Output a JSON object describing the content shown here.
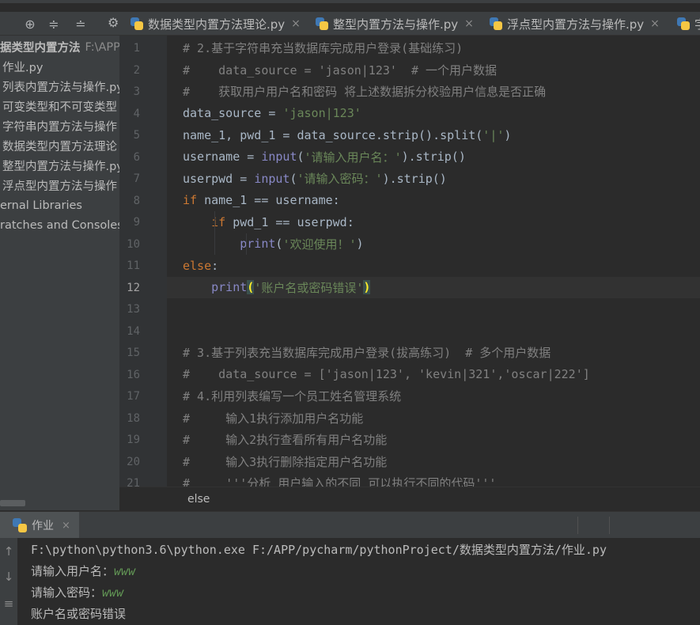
{
  "top_strip": {
    "label": "1 作业.py"
  },
  "toolbar": {
    "icons": [
      "target-icon",
      "collapse-all-icon",
      "expand-all-icon",
      "gear-icon"
    ]
  },
  "tabs": [
    {
      "label": "数据类型内置方法理论.py",
      "close": "×"
    },
    {
      "label": "整型内置方法与操作.py",
      "close": "×"
    },
    {
      "label": "浮点型内置方法与操作.py",
      "close": "×"
    },
    {
      "label": "字",
      "close": ""
    }
  ],
  "project": {
    "root_label": "据类型内置方法",
    "root_path": "F:\\APP",
    "items": [
      "作业.py",
      "列表内置方法与操作.py",
      "可变类型和不可变类型",
      "字符串内置方法与操作",
      "数据类型内置方法理论",
      "整型内置方法与操作.py",
      "浮点型内置方法与操作",
      "ernal Libraries",
      "ratches and Consoles"
    ]
  },
  "editor": {
    "current_line": 12,
    "line_numbers": [
      "1",
      "2",
      "3",
      "4",
      "5",
      "6",
      "7",
      "8",
      "9",
      "10",
      "11",
      "12",
      "13",
      "14",
      "15",
      "16",
      "17",
      "18",
      "19",
      "20",
      "21"
    ],
    "lines": [
      {
        "indent": "",
        "tokens": [
          {
            "t": "# 2.基于字符串充当数据库完成用户登录(基础练习)",
            "c": "c-comment"
          }
        ]
      },
      {
        "indent": "",
        "tokens": [
          {
            "t": "#    data_source = 'jason|123'  # 一个用户数据",
            "c": "c-comment"
          }
        ]
      },
      {
        "indent": "",
        "tokens": [
          {
            "t": "#    获取用户用户名和密码 将上述数据拆分校验用户信息是否正确",
            "c": "c-comment"
          }
        ]
      },
      {
        "indent": "",
        "tokens": [
          {
            "t": "data_source = ",
            "c": "c-var"
          },
          {
            "t": "'jason|123'",
            "c": "c-str"
          }
        ]
      },
      {
        "indent": "",
        "tokens": [
          {
            "t": "name_1, pwd_1 = data_source.strip().split(",
            "c": "c-var"
          },
          {
            "t": "'|'",
            "c": "c-str"
          },
          {
            "t": ")",
            "c": "c-var"
          }
        ]
      },
      {
        "indent": "",
        "tokens": [
          {
            "t": "username = ",
            "c": "c-var"
          },
          {
            "t": "input",
            "c": "c-fn"
          },
          {
            "t": "(",
            "c": "c-var"
          },
          {
            "t": "'请输入用户名：'",
            "c": "c-str"
          },
          {
            "t": ").strip()",
            "c": "c-var"
          }
        ]
      },
      {
        "indent": "",
        "tokens": [
          {
            "t": "userpwd = ",
            "c": "c-var"
          },
          {
            "t": "input",
            "c": "c-fn"
          },
          {
            "t": "(",
            "c": "c-var"
          },
          {
            "t": "'请输入密码：'",
            "c": "c-str"
          },
          {
            "t": ").strip()",
            "c": "c-var"
          }
        ]
      },
      {
        "indent": "",
        "tokens": [
          {
            "t": "if",
            "c": "c-kw"
          },
          {
            "t": " name_1 == username:",
            "c": "c-var"
          }
        ]
      },
      {
        "indent": "    ",
        "tokens": [
          {
            "t": "if",
            "c": "c-kw"
          },
          {
            "t": " pwd_1 == userpwd:",
            "c": "c-var"
          }
        ]
      },
      {
        "indent": "        ",
        "tokens": [
          {
            "t": "print",
            "c": "c-fn"
          },
          {
            "t": "(",
            "c": "c-var"
          },
          {
            "t": "'欢迎使用！'",
            "c": "c-str"
          },
          {
            "t": ")",
            "c": "c-var"
          }
        ]
      },
      {
        "indent": "",
        "tokens": [
          {
            "t": "else",
            "c": "c-kw"
          },
          {
            "t": ":",
            "c": "c-var"
          }
        ]
      },
      {
        "indent": "    ",
        "tokens": [
          {
            "t": "print",
            "c": "c-fn"
          },
          {
            "t": "(",
            "c": "bm"
          },
          {
            "t": "'账户名或密码错误'",
            "c": "c-str"
          },
          {
            "t": ")",
            "c": "bm"
          }
        ]
      },
      {
        "indent": "",
        "tokens": []
      },
      {
        "indent": "",
        "tokens": []
      },
      {
        "indent": "",
        "tokens": [
          {
            "t": "# 3.基于列表充当数据库完成用户登录(拔高练习)  # 多个用户数据",
            "c": "c-comment"
          }
        ]
      },
      {
        "indent": "",
        "tokens": [
          {
            "t": "#    data_source = ['jason|123', 'kevin|321','oscar|222']",
            "c": "c-comment"
          }
        ]
      },
      {
        "indent": "",
        "tokens": [
          {
            "t": "# 4.利用列表编写一个员工姓名管理系统",
            "c": "c-comment"
          }
        ]
      },
      {
        "indent": "",
        "tokens": [
          {
            "t": "#     输入1执行添加用户名功能",
            "c": "c-comment"
          }
        ]
      },
      {
        "indent": "",
        "tokens": [
          {
            "t": "#     输入2执行查看所有用户名功能",
            "c": "c-comment"
          }
        ]
      },
      {
        "indent": "",
        "tokens": [
          {
            "t": "#     输入3执行删除指定用户名功能",
            "c": "c-comment"
          }
        ]
      },
      {
        "indent": "",
        "tokens": [
          {
            "t": "#     '''分析 用户输入的不同 可以执行不同的代码'''",
            "c": "c-comment"
          }
        ]
      }
    ]
  },
  "breadcrumb": {
    "text": "else"
  },
  "run": {
    "tab_label": "作业",
    "tab_close": "×",
    "side_icons": [
      "up-arrow-icon",
      "down-arrow-icon",
      "wrap-icon"
    ],
    "console": {
      "command": "F:\\python\\python3.6\\python.exe F:/APP/pycharm/pythonProject/数据类型内置方法/作业.py",
      "prompt_user": "请输入用户名：",
      "input_user": "www",
      "prompt_pwd": "请输入密码：",
      "input_pwd": "www",
      "result": "账户名或密码错误"
    }
  }
}
